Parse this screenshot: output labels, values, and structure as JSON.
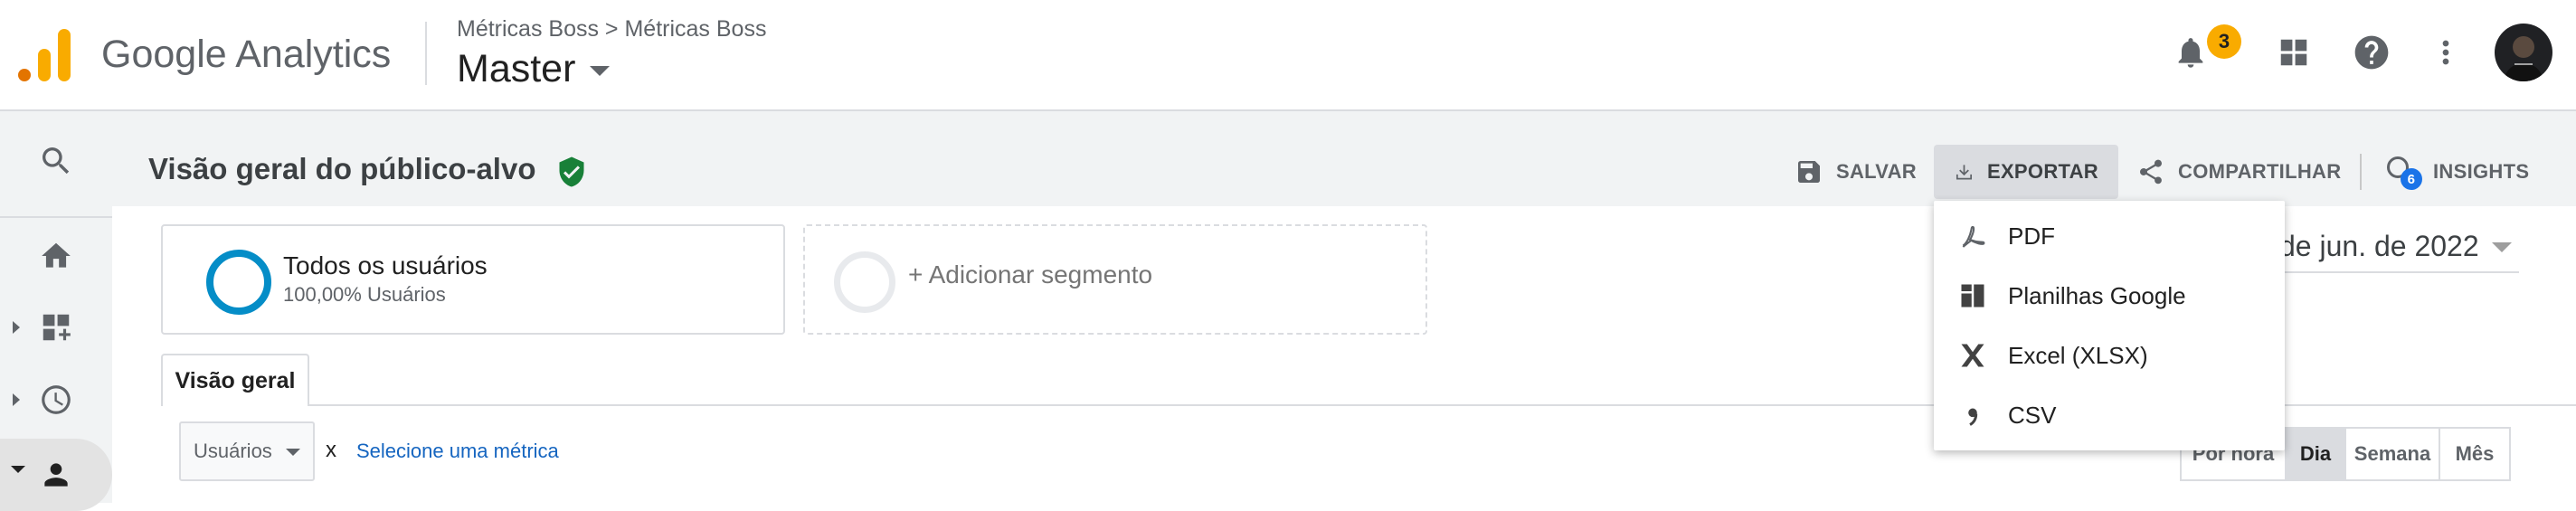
{
  "header": {
    "product_name": "Google Analytics",
    "breadcrumb": "Métricas Boss > Métricas Boss",
    "view_name": "Master",
    "notification_count": "3"
  },
  "page": {
    "title": "Visão geral do público-alvo"
  },
  "actions": {
    "save": "SALVAR",
    "export": "EXPORTAR",
    "share": "COMPARTILHAR",
    "insights": "INSIGHTS",
    "insights_badge": "6"
  },
  "export_menu": {
    "items": [
      {
        "label": "PDF",
        "icon": "pdf-icon"
      },
      {
        "label": "Planilhas Google",
        "icon": "sheets-icon"
      },
      {
        "label": "Excel (XLSX)",
        "icon": "excel-icon"
      },
      {
        "label": "CSV",
        "icon": "csv-icon"
      }
    ]
  },
  "segments": {
    "active_name": "Todos os usuários",
    "active_sub": "100,00% Usuários",
    "add_label": "+ Adicionar segmento"
  },
  "date_range": "de jun. de 2022",
  "tabs": {
    "overview": "Visão geral"
  },
  "chart_controls": {
    "metric": "Usuários",
    "vs": "x",
    "select_metric": "Selecione uma métrica",
    "granularity": [
      "Por hora",
      "Dia",
      "Semana",
      "Mês"
    ],
    "selected_granularity": "Dia"
  },
  "colors": {
    "accent_orange": "#f9ab00",
    "segment_blue": "#058dc7",
    "verified_green": "#188038",
    "link_blue": "#1565c0"
  }
}
